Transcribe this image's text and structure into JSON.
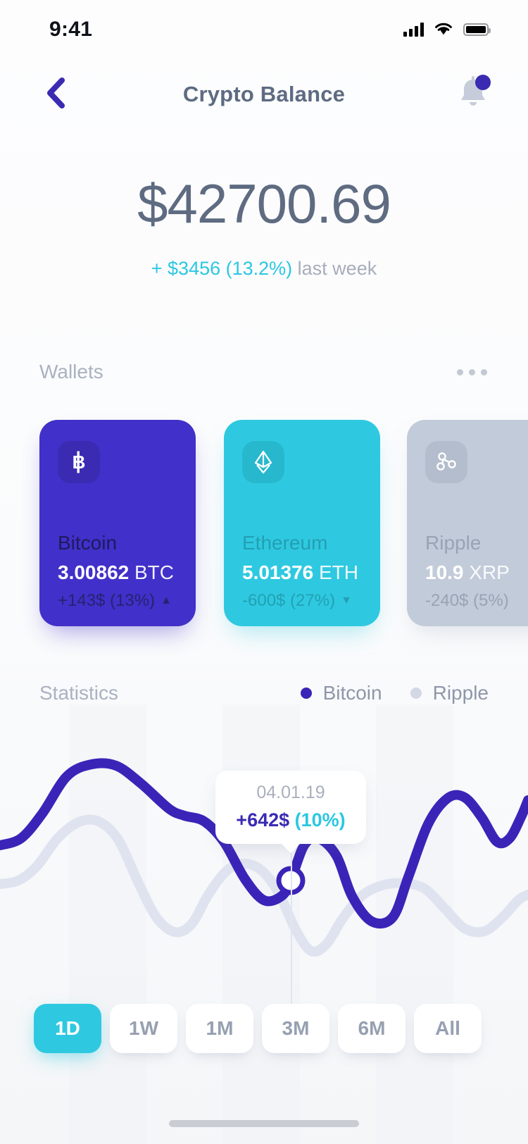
{
  "status_bar": {
    "time": "9:41",
    "signal_icon": "cellular-bars-icon",
    "wifi_icon": "wifi-icon",
    "battery_icon": "battery-full-icon"
  },
  "header": {
    "back_icon": "chevron-left-icon",
    "title": "Crypto Balance",
    "bell_icon": "bell-icon",
    "has_notification_dot": true
  },
  "balance": {
    "amount": "$42700.69",
    "change": "+ $3456 (13.2%)",
    "change_period": " last week"
  },
  "wallets_section": {
    "title": "Wallets",
    "more_icon": "more-horizontal-icon",
    "cards": [
      {
        "name": "Bitcoin",
        "icon": "bitcoin-icon",
        "amount": "3.00862",
        "unit": " BTC",
        "change": "+143$ (13%)",
        "direction": "up",
        "caret": "▲",
        "color": "#4130c9"
      },
      {
        "name": "Ethereum",
        "icon": "ethereum-icon",
        "amount": "5.01376",
        "unit": " ETH",
        "change": "-600$ (27%)",
        "direction": "down",
        "caret": "▼",
        "color": "#2ec9e0"
      },
      {
        "name": "Ripple",
        "icon": "ripple-icon",
        "amount": "10.9",
        "unit": " XRP",
        "change": "-240$ (5%)",
        "direction": "down",
        "caret": "",
        "color": "#c2cbd9"
      }
    ]
  },
  "statistics_section": {
    "title": "Statistics",
    "legend": [
      {
        "label": "Bitcoin",
        "color": "#3a24b8"
      },
      {
        "label": "Ripple",
        "color": "#d2d8e6"
      }
    ]
  },
  "tooltip": {
    "date": "04.01.19",
    "value": "+642$",
    "percent": "(10%)"
  },
  "ranges": {
    "active": "1D",
    "options": [
      "1D",
      "1W",
      "1M",
      "3M",
      "6M",
      "All"
    ]
  },
  "chart_data": {
    "type": "line",
    "title": "Statistics",
    "xlabel": "",
    "ylabel": "",
    "grid": false,
    "legend_position": "top-right",
    "axis_hidden": true,
    "selected_point": {
      "x_label": "04.01.19",
      "value": "+642$",
      "percent": "10%"
    },
    "series": [
      {
        "name": "Bitcoin",
        "color": "#3a24b8",
        "width": 14,
        "points": [
          [
            0,
            160
          ],
          [
            30,
            150
          ],
          [
            60,
            115
          ],
          [
            95,
            62
          ],
          [
            130,
            45
          ],
          [
            165,
            47
          ],
          [
            200,
            72
          ],
          [
            240,
            108
          ],
          [
            262,
            118
          ],
          [
            290,
            126
          ],
          [
            318,
            155
          ],
          [
            348,
            208
          ],
          [
            375,
            238
          ],
          [
            400,
            232
          ],
          [
            413,
            210
          ],
          [
            432,
            160
          ],
          [
            452,
            150
          ],
          [
            478,
            175
          ],
          [
            500,
            232
          ],
          [
            528,
            268
          ],
          [
            558,
            262
          ],
          [
            580,
            205
          ],
          [
            608,
            130
          ],
          [
            636,
            93
          ],
          [
            660,
            92
          ],
          [
            684,
            120
          ],
          [
            706,
            155
          ],
          [
            724,
            150
          ],
          [
            740,
            120
          ],
          [
            750,
            96
          ]
        ]
      },
      {
        "name": "Ripple",
        "color": "#dfe3ef",
        "width": 14,
        "points": [
          [
            0,
            215
          ],
          [
            26,
            210
          ],
          [
            52,
            190
          ],
          [
            82,
            150
          ],
          [
            112,
            127
          ],
          [
            140,
            126
          ],
          [
            168,
            152
          ],
          [
            196,
            212
          ],
          [
            222,
            262
          ],
          [
            248,
            283
          ],
          [
            272,
            272
          ],
          [
            296,
            230
          ],
          [
            322,
            196
          ],
          [
            346,
            186
          ],
          [
            372,
            196
          ],
          [
            396,
            228
          ],
          [
            420,
            280
          ],
          [
            442,
            310
          ],
          [
            464,
            300
          ],
          [
            488,
            262
          ],
          [
            516,
            230
          ],
          [
            546,
            216
          ],
          [
            576,
            214
          ],
          [
            604,
            222
          ],
          [
            632,
            250
          ],
          [
            660,
            278
          ],
          [
            688,
            282
          ],
          [
            714,
            262
          ],
          [
            736,
            238
          ],
          [
            750,
            230
          ]
        ]
      }
    ]
  }
}
